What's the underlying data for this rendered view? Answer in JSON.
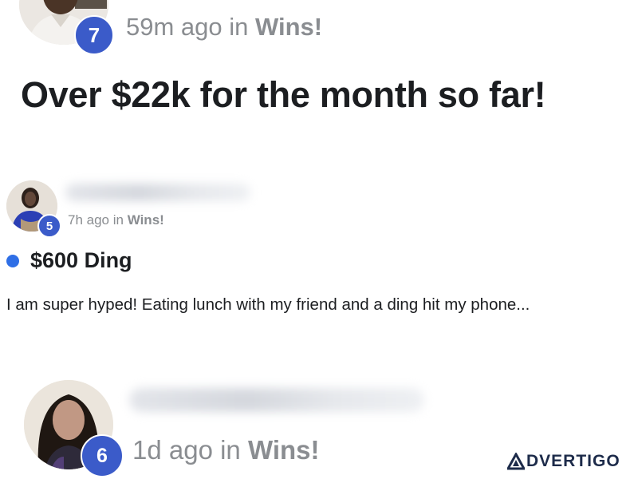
{
  "posts": [
    {
      "badge": "7",
      "time": "59m ago in ",
      "group": "Wins!",
      "title": "Over $22k for the month so far!"
    },
    {
      "badge": "5",
      "time": "7h ago in ",
      "group": "Wins!",
      "title": "$600 Ding",
      "body": "I am super hyped! Eating lunch with my friend and a ding hit my phone..."
    },
    {
      "badge": "6",
      "time": "1d ago in ",
      "group": "Wins!"
    }
  ],
  "colors": {
    "badge": "#3b5bc9",
    "unread_dot": "#2f6fe6",
    "meta_text": "#8a8d91",
    "watermark": "#1d2b4a"
  },
  "watermark": {
    "text": "DVERTIGO",
    "logo_letter_icon": "triangle-a-icon"
  }
}
